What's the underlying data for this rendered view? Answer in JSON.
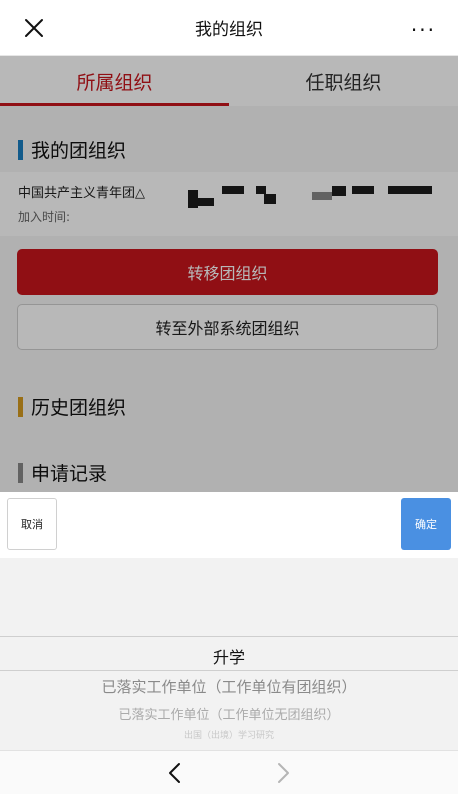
{
  "header": {
    "title": "我的组织",
    "more_label": "···"
  },
  "tabs": [
    {
      "label": "所属组织",
      "active": true
    },
    {
      "label": "任职组织",
      "active": false
    }
  ],
  "my_org": {
    "section_title": "我的团组织",
    "org_name": "中国共产主义青年团△",
    "joined_label": "加入时间:",
    "bar_color": "#1a7fc1"
  },
  "buttons": {
    "transfer": "转移团组织",
    "transfer_external": "转至外部系统团组织"
  },
  "history": {
    "section_title": "历史团组织",
    "bar_color": "#d49a1f"
  },
  "applications": {
    "section_title": "申请记录",
    "bar_color": "#888888"
  },
  "picker": {
    "cancel": "取消",
    "confirm": "确定",
    "selected": "升学",
    "options": [
      "已落实工作单位（工作单位有团组织）",
      "已落实工作单位（工作单位无团组织）",
      "出国（出境）学习研究"
    ]
  },
  "colors": {
    "accent_red": "#c8161d",
    "confirm_blue": "#4a90e2"
  },
  "icons": {
    "close": "close-icon",
    "more": "more-icon",
    "back": "chevron-left-icon",
    "forward": "chevron-right-icon"
  }
}
